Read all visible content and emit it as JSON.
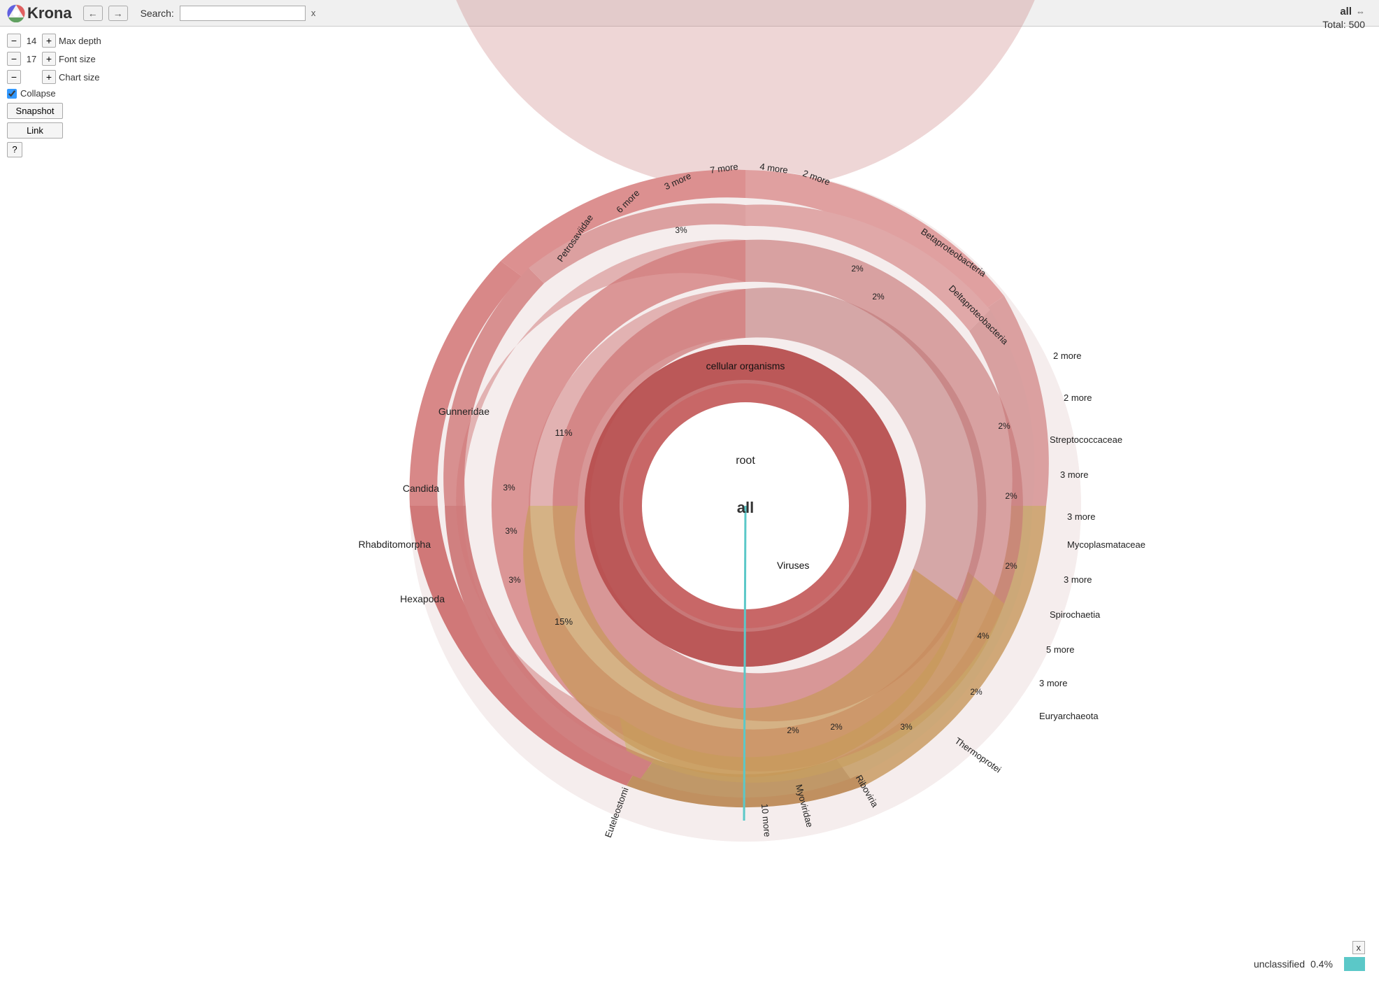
{
  "header": {
    "logo_text": "Krona",
    "nav_back": "←",
    "nav_forward": "→",
    "search_label": "Search:",
    "search_placeholder": "",
    "search_clear": "x"
  },
  "top_right": {
    "all_label": "all",
    "expand_icon": "⇔",
    "total_label": "Total:",
    "total_value": "500"
  },
  "controls": {
    "max_depth_label": "Max depth",
    "max_depth_value": "14",
    "font_size_label": "Font size",
    "font_size_value": "17",
    "chart_size_label": "Chart size",
    "collapse_label": "Collapse",
    "snapshot_label": "Snapshot",
    "link_label": "Link",
    "help_label": "?"
  },
  "legend": {
    "x_label": "x",
    "item_label": "unclassified",
    "item_pct": "0.4%",
    "item_color": "#5bc8c8"
  },
  "chart": {
    "center_label": "all",
    "root_label": "root",
    "cellular_label": "cellular organisms",
    "viruses_label": "Viruses",
    "segments": [
      {
        "label": "Gunneridae",
        "pct": "11%"
      },
      {
        "label": "Petrosaviidae",
        "pct": ""
      },
      {
        "label": "6 more",
        "pct": ""
      },
      {
        "label": "3 more",
        "pct": "3%"
      },
      {
        "label": "7 more",
        "pct": ""
      },
      {
        "label": "4 more",
        "pct": ""
      },
      {
        "label": "2 more",
        "pct": ""
      },
      {
        "label": "Betaproteobacteria",
        "pct": "2%"
      },
      {
        "label": "Deltaproteobacteria",
        "pct": "2%"
      },
      {
        "label": "2 more",
        "pct": ""
      },
      {
        "label": "2 more",
        "pct": ""
      },
      {
        "label": "Streptococcaceae",
        "pct": "2%"
      },
      {
        "label": "3 more",
        "pct": ""
      },
      {
        "label": "3 more",
        "pct": ""
      },
      {
        "label": "2%",
        "pct": ""
      },
      {
        "label": "Mycoplasmataceae",
        "pct": ""
      },
      {
        "label": "3 more",
        "pct": ""
      },
      {
        "label": "2%",
        "pct": ""
      },
      {
        "label": "Spirochaetia",
        "pct": ""
      },
      {
        "label": "5 more",
        "pct": ""
      },
      {
        "label": "3 more",
        "pct": ""
      },
      {
        "label": "4%",
        "pct": ""
      },
      {
        "label": "Euryarchaeota",
        "pct": ""
      },
      {
        "label": "2%",
        "pct": ""
      },
      {
        "label": "Thermoprotei",
        "pct": ""
      },
      {
        "label": "3%",
        "pct": ""
      },
      {
        "label": "Riboviria",
        "pct": ""
      },
      {
        "label": "2%",
        "pct": ""
      },
      {
        "label": "Myoviridae",
        "pct": ""
      },
      {
        "label": "10 more",
        "pct": ""
      },
      {
        "label": "Euteleostomi",
        "pct": "15%"
      },
      {
        "label": "Hexapoda",
        "pct": "3%"
      },
      {
        "label": "Rhabditomorpha",
        "pct": "3%"
      },
      {
        "label": "Candida",
        "pct": "3%"
      }
    ]
  }
}
